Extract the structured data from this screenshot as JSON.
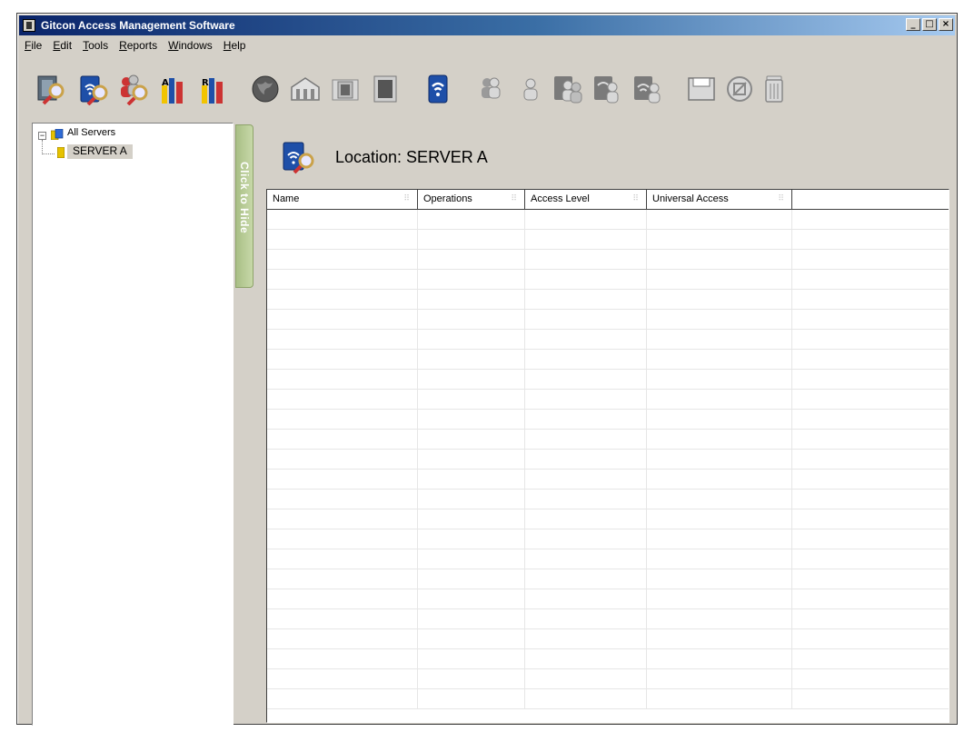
{
  "window": {
    "title": "Gitcon Access Management Software"
  },
  "window_buttons": {
    "minimize": "_",
    "maximize": "□",
    "close": "×"
  },
  "menu": [
    {
      "label": "File",
      "mnemonic": "F"
    },
    {
      "label": "Edit",
      "mnemonic": "E"
    },
    {
      "label": "Tools",
      "mnemonic": "T"
    },
    {
      "label": "Reports",
      "mnemonic": "R"
    },
    {
      "label": "Windows",
      "mnemonic": "W"
    },
    {
      "label": "Help",
      "mnemonic": "H"
    }
  ],
  "toolbar": [
    {
      "icon": "find-door-icon",
      "enabled": true
    },
    {
      "icon": "find-reader-icon",
      "enabled": true
    },
    {
      "icon": "find-users-icon",
      "enabled": true
    },
    {
      "icon": "report-a-icon",
      "enabled": true
    },
    {
      "icon": "report-b-icon",
      "enabled": true
    },
    {
      "icon": "globe-icon",
      "enabled": false
    },
    {
      "icon": "building-icon",
      "enabled": false
    },
    {
      "icon": "door-panel-icon",
      "enabled": false
    },
    {
      "icon": "door-icon",
      "enabled": false
    },
    {
      "icon": "reader-icon",
      "enabled": true
    },
    {
      "icon": "user-group-icon",
      "enabled": false
    },
    {
      "icon": "user-icon",
      "enabled": false
    },
    {
      "icon": "group-access-icon",
      "enabled": false
    },
    {
      "icon": "group-reader-icon",
      "enabled": false
    },
    {
      "icon": "group-wireless-icon",
      "enabled": false
    },
    {
      "icon": "save-icon",
      "enabled": false
    },
    {
      "icon": "cancel-icon",
      "enabled": false
    },
    {
      "icon": "trash-icon",
      "enabled": false
    }
  ],
  "tree": {
    "root": {
      "label": "All Servers",
      "expander": "−"
    },
    "children": [
      {
        "label": "SERVER A",
        "selected": true
      }
    ]
  },
  "hide_tab": {
    "label": "Click to Hide"
  },
  "location": {
    "text": "Location: SERVER A"
  },
  "grid": {
    "columns": [
      "Name",
      "Operations",
      "Access Level",
      "Universal Access",
      ""
    ],
    "rows": 25
  },
  "colors": {
    "titlebar_start": "#0a246a",
    "titlebar_end": "#a6caf0",
    "window_bg": "#d4d0c8",
    "hide_tab": "#b5c996",
    "tree_selected_bg": "#d4d0c8"
  }
}
